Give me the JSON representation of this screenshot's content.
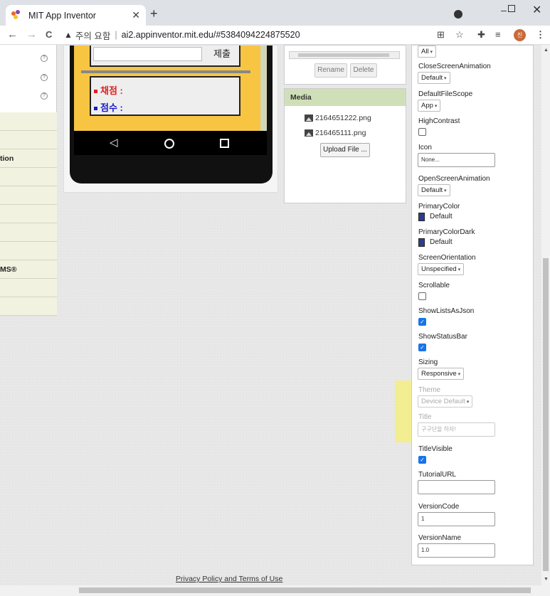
{
  "browser": {
    "tab_title": "MIT App Inventor",
    "tab_close": "✕",
    "new_tab": "+",
    "win_min": "–",
    "win_close": "✕",
    "back": "←",
    "forward": "→",
    "reload": "C",
    "warn_icon": "▲",
    "warn_text": "주의 요함",
    "separator": "|",
    "url": "ai2.appinventor.mit.edu/#5384094224875520",
    "avatar_initial": "진",
    "menu_icon": "⋮"
  },
  "left_panel": {
    "help_glyph": "?",
    "rows": [
      "",
      "",
      "tion",
      "",
      "",
      "",
      "",
      "",
      "MS®",
      "",
      ""
    ]
  },
  "phone": {
    "submit_label": "제출",
    "result1_label": "채점 :",
    "result2_label": "점수 :",
    "nav_back": "◁"
  },
  "assets": {
    "rename_label": "Rename",
    "delete_label": "Delete",
    "media_title": "Media",
    "files": [
      "2164651222.png",
      "216465111.png"
    ],
    "upload_label": "Upload File ..."
  },
  "properties": {
    "align_value": "All",
    "close_anim_label": "CloseScreenAnimation",
    "close_anim_value": "Default",
    "file_scope_label": "DefaultFileScope",
    "file_scope_value": "App",
    "high_contrast_label": "HighContrast",
    "icon_label": "Icon",
    "icon_value": "None...",
    "open_anim_label": "OpenScreenAnimation",
    "open_anim_value": "Default",
    "primary_color_label": "PrimaryColor",
    "primary_color_value": "Default",
    "primary_dark_label": "PrimaryColorDark",
    "primary_dark_value": "Default",
    "orientation_label": "ScreenOrientation",
    "orientation_value": "Unspecified",
    "scrollable_label": "Scrollable",
    "show_lists_label": "ShowListsAsJson",
    "show_status_label": "ShowStatusBar",
    "sizing_label": "Sizing",
    "sizing_value": "Responsive",
    "theme_label": "Theme",
    "theme_value": "Device Default",
    "title_label": "Title",
    "title_value": "구구단을 하자!",
    "title_visible_label": "TitleVisible",
    "tutorial_label": "TutorialURL",
    "version_code_label": "VersionCode",
    "version_code_value": "1",
    "version_name_label": "VersionName",
    "version_name_value": "1.0",
    "check_mark": "✓"
  },
  "footer": {
    "privacy_label": "Privacy Policy and Terms of Use"
  },
  "colors": {
    "phone_bg": "#f8c543",
    "result1_color": "#e02020",
    "result2_color": "#1a1acc",
    "primary_color": "#2e3d8f",
    "highlight": "#fff43c"
  }
}
